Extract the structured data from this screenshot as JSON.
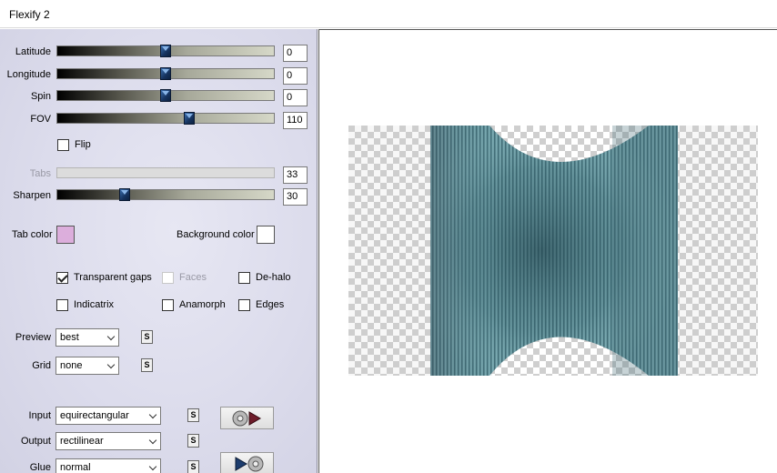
{
  "window": {
    "title": "Flexify 2"
  },
  "controls": {
    "sliders": [
      {
        "id": "latitude",
        "label": "Latitude",
        "value": "0",
        "position": 0.5
      },
      {
        "id": "longitude",
        "label": "Longitude",
        "value": "0",
        "position": 0.5
      },
      {
        "id": "spin",
        "label": "Spin",
        "value": "0",
        "position": 0.5
      },
      {
        "id": "fov",
        "label": "FOV",
        "value": "110",
        "position": 0.61
      },
      {
        "id": "tabs",
        "label": "Tabs",
        "value": "33",
        "position": 0.33,
        "disabled": true
      },
      {
        "id": "sharpen",
        "label": "Sharpen",
        "value": "30",
        "position": 0.31
      }
    ],
    "flip": {
      "label": "Flip",
      "checked": false
    },
    "tab_color": {
      "label": "Tab color",
      "color": "#dcaedc"
    },
    "background_color": {
      "label": "Background color",
      "color": "#ffffff"
    },
    "checkboxes": [
      {
        "id": "transparent-gaps",
        "label": "Transparent gaps",
        "checked": true,
        "disabled": false
      },
      {
        "id": "faces",
        "label": "Faces",
        "checked": false,
        "disabled": true
      },
      {
        "id": "de-halo",
        "label": "De-halo",
        "checked": false,
        "disabled": false
      },
      {
        "id": "indicatrix",
        "label": "Indicatrix",
        "checked": false,
        "disabled": false
      },
      {
        "id": "anamorph",
        "label": "Anamorph",
        "checked": false,
        "disabled": false
      },
      {
        "id": "edges",
        "label": "Edges",
        "checked": false,
        "disabled": false
      }
    ],
    "preview": {
      "label": "Preview",
      "value": "best"
    },
    "grid": {
      "label": "Grid",
      "value": "none"
    },
    "input": {
      "label": "Input",
      "value": "equirectangular"
    },
    "output": {
      "label": "Output",
      "value": "rectilinear"
    },
    "glue": {
      "label": "Glue",
      "value": "normal"
    },
    "s_button_label": "S"
  },
  "colors": {
    "panel_bg": "#dcdcec",
    "thumb": "#16335e",
    "preview_teal": "#5f8e97",
    "checker_light": "#ffffff",
    "checker_dark": "#cfcfcf"
  }
}
